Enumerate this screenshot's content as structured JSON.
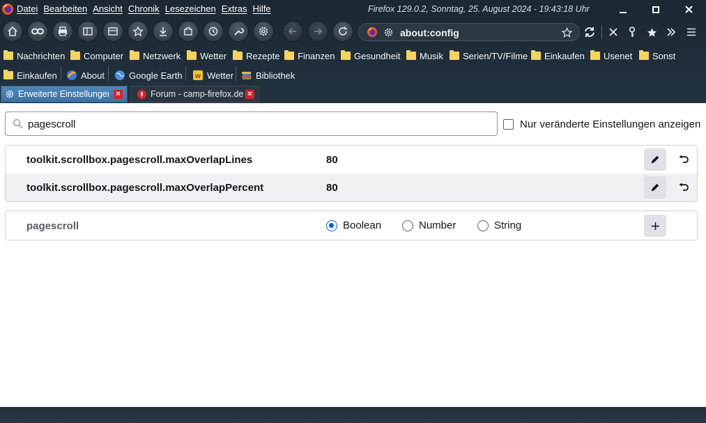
{
  "menubar": {
    "items": [
      "Datei",
      "Bearbeiten",
      "Ansicht",
      "Chronik",
      "Lesezeichen",
      "Extras",
      "Hilfe"
    ],
    "window_title": "Firefox 129.0.2, Sonntag, 25. August 2024 - 19:43:18 Uhr"
  },
  "navbar": {
    "url": "about:config"
  },
  "bookmarks": {
    "row1": [
      "Nachrichten",
      "Computer",
      "Netzwerk",
      "Wetter",
      "Rezepte",
      "Finanzen",
      "Gesundheit",
      "Musik",
      "Serien/TV/Filme",
      "Einkaufen",
      "Usenet",
      "Sonst"
    ],
    "row2": [
      "Einkaufen",
      "About",
      "Google Earth",
      "Wetter",
      "Bibliothek"
    ]
  },
  "tabs": [
    {
      "label": "Erweiterte Einstellungen"
    },
    {
      "label": "Forum - camp-firefox.de"
    }
  ],
  "config": {
    "search_value": "pagescroll",
    "modified_only_label": "Nur veränderte Einstellungen anzeigen",
    "prefs": [
      {
        "name": "toolkit.scrollbox.pagescroll.maxOverlapLines",
        "value": "80"
      },
      {
        "name": "toolkit.scrollbox.pagescroll.maxOverlapPercent",
        "value": "80"
      }
    ],
    "new_pref": {
      "name": "pagescroll",
      "types": [
        "Boolean",
        "Number",
        "String"
      ],
      "selected_type": "Boolean"
    }
  }
}
